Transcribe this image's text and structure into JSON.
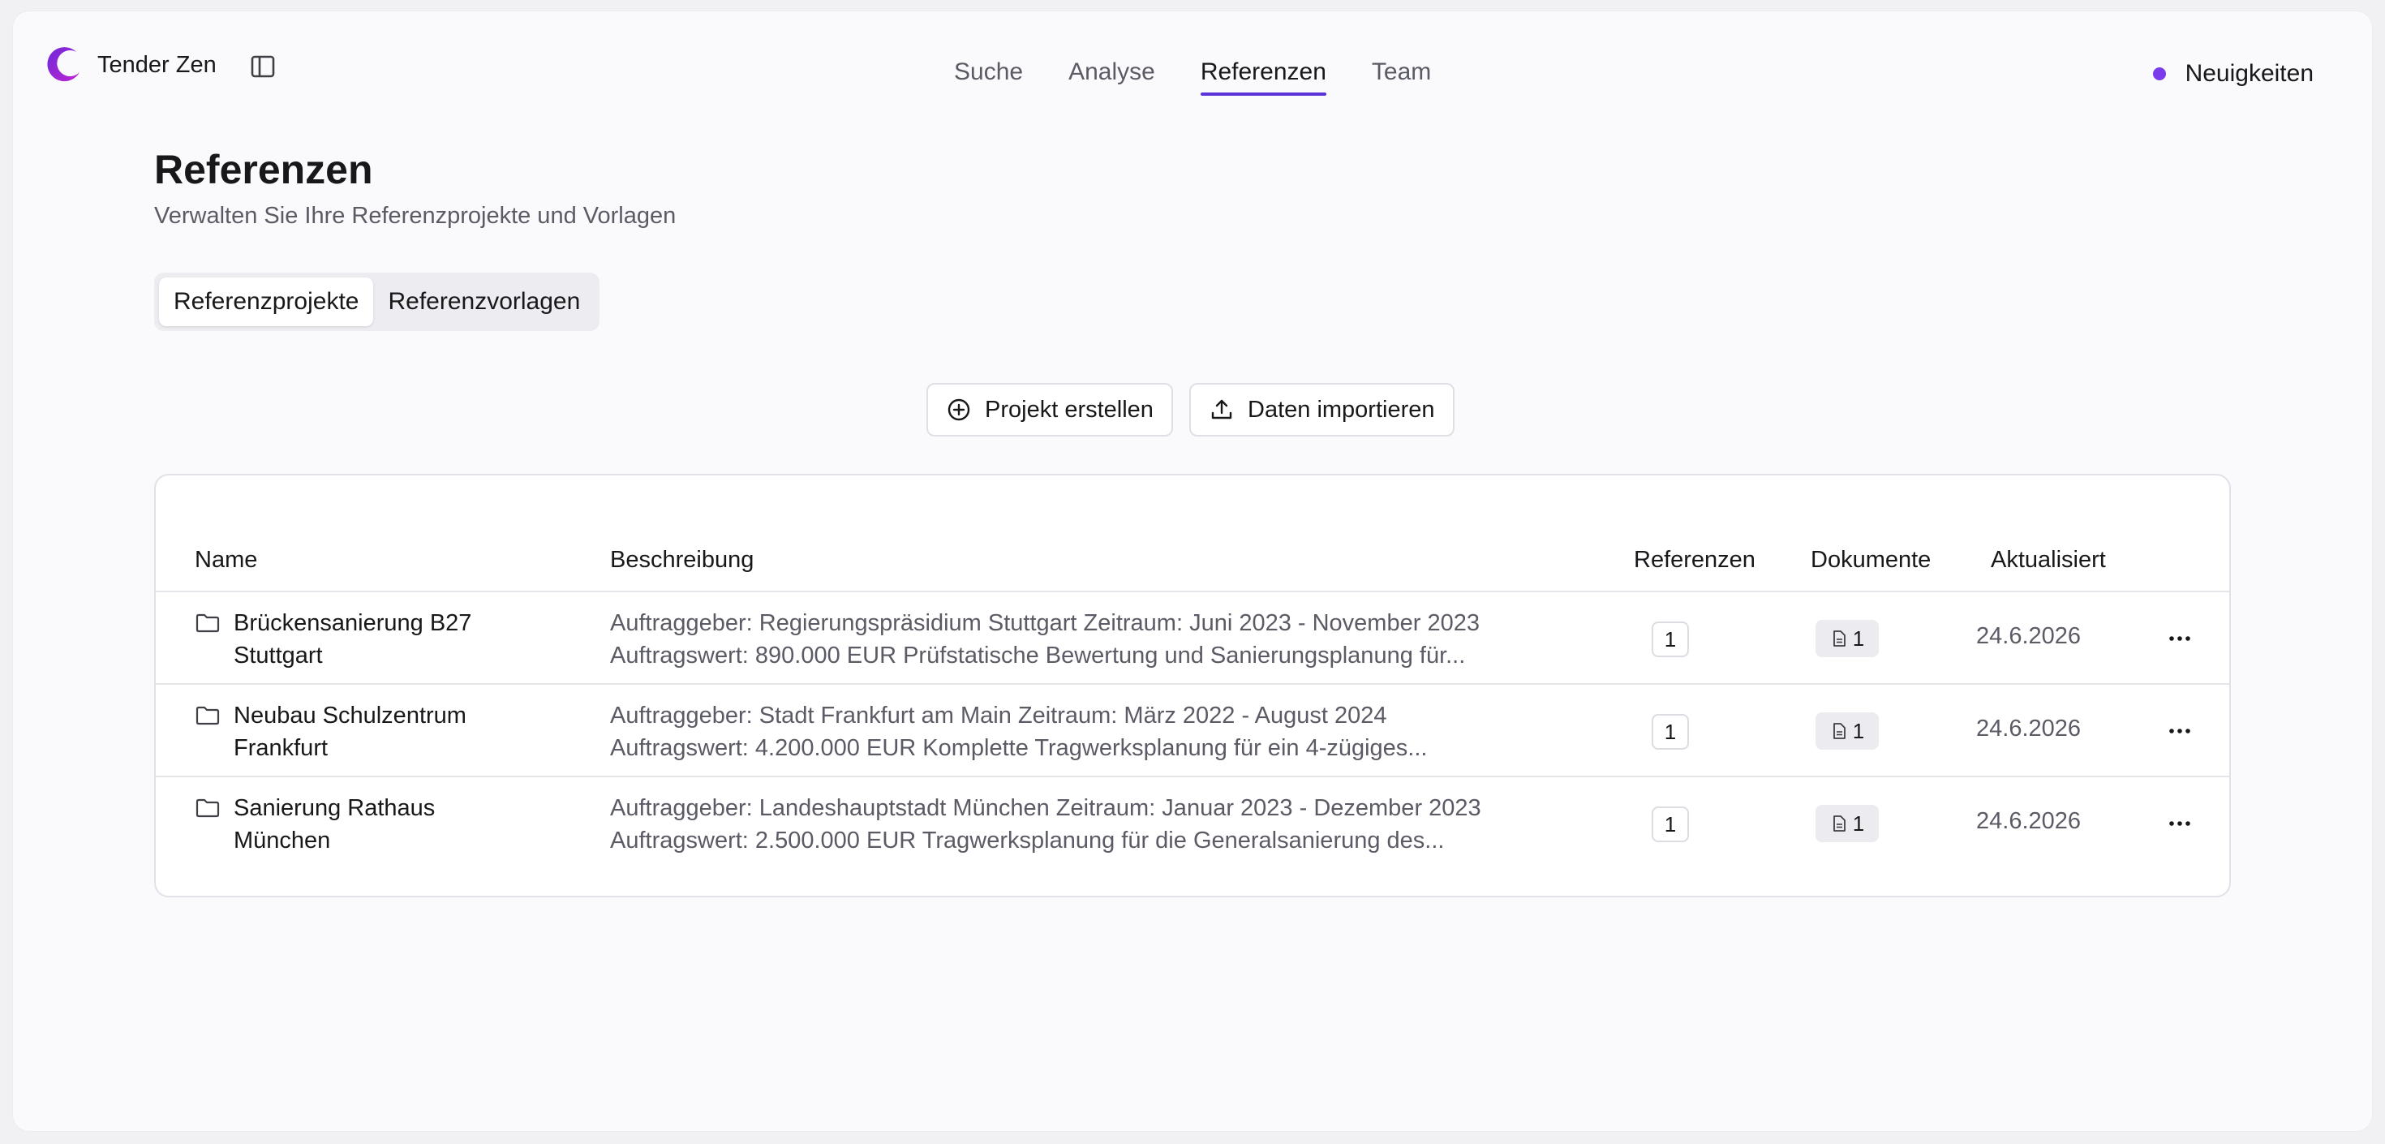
{
  "app": {
    "name": "Tender Zen"
  },
  "icons": {
    "logo": "crescent-logo",
    "sidebar": "sidebar-toggle-icon",
    "news": "dot",
    "create": "plus-circle-icon",
    "import": "upload-icon",
    "folder": "folder-icon",
    "document": "document-icon",
    "more": "ellipsis-icon"
  },
  "colors": {
    "accent": "#5b34d9",
    "dot": "#7c3aed"
  },
  "nav": {
    "items": [
      "Suche",
      "Analyse",
      "Referenzen",
      "Team"
    ],
    "active": "Referenzen"
  },
  "news_label": "Neuigkeiten",
  "header": {
    "title": "Referenzen",
    "subtitle": "Verwalten Sie Ihre Referenzprojekte und Vorlagen"
  },
  "tabs": [
    {
      "label": "Referenzprojekte",
      "active": true
    },
    {
      "label": "Referenzvorlagen",
      "active": false
    }
  ],
  "actions": {
    "create": "Projekt erstellen",
    "import": "Daten importieren"
  },
  "table": {
    "columns": [
      "Name",
      "Beschreibung",
      "Referenzen",
      "Dokumente",
      "Aktualisiert"
    ],
    "rows": [
      {
        "name": "Brückensanierung B27 Stuttgart",
        "description": "Auftraggeber: Regierungspräsidium Stuttgart Zeitraum: Juni 2023 - November 2023 Auftragswert: 890.000 EUR Prüfstatische Bewertung und Sanierungsplanung für...",
        "references": "1",
        "documents": "1",
        "updated": "24.6.2026"
      },
      {
        "name": "Neubau Schulzentrum Frankfurt",
        "description": "Auftraggeber: Stadt Frankfurt am Main Zeitraum: März 2022 - August 2024 Auftragswert: 4.200.000 EUR Komplette Tragwerksplanung für ein 4-zügiges...",
        "references": "1",
        "documents": "1",
        "updated": "24.6.2026"
      },
      {
        "name": "Sanierung Rathaus München",
        "description": "Auftraggeber: Landeshauptstadt München Zeitraum: Januar 2023 - Dezember 2023 Auftragswert: 2.500.000 EUR Tragwerksplanung für die Generalsanierung des...",
        "references": "1",
        "documents": "1",
        "updated": "24.6.2026"
      }
    ]
  }
}
